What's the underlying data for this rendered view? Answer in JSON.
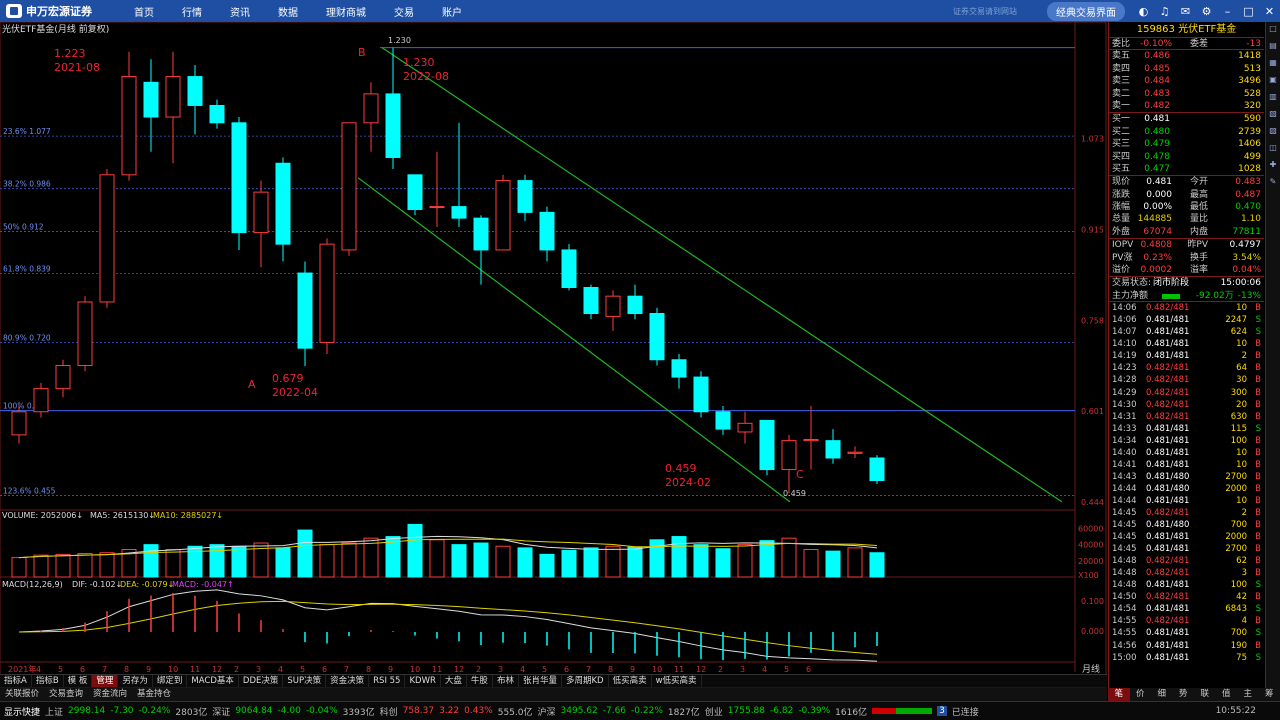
{
  "app": {
    "logo": "申万宏源证券",
    "nav": [
      "首页",
      "行情",
      "资讯",
      "数据",
      "理财商城",
      "交易",
      "账户"
    ],
    "hint": "证券交易请到网站",
    "classic_btn": "经典交易界面"
  },
  "chart": {
    "title": "光伏ETF基金(月线 前复权)",
    "fib_levels": [
      {
        "label": "23.6% 1.077",
        "value": 1.077
      },
      {
        "label": "38.2% 0.986",
        "value": 0.986
      },
      {
        "label": "50% 0.912",
        "value": 0.912
      },
      {
        "label": "61.8% 0.839",
        "value": 0.839
      },
      {
        "label": "80.9% 0.720",
        "value": 0.72
      },
      {
        "label": "100% 0.602",
        "value": 0.602
      },
      {
        "label": "123.6% 0.455",
        "value": 0.455
      }
    ],
    "y_ticks": [
      "1.073",
      "0.915",
      "0.758",
      "0.601",
      "0.444"
    ],
    "points": {
      "A": "A",
      "B": "B",
      "C": "C"
    },
    "annotations": [
      {
        "t1": "1.223",
        "t2": "2021-08"
      },
      {
        "t1": "1.230",
        "t2": "2022-08"
      },
      {
        "t1": "0.679",
        "t2": "2022-04"
      },
      {
        "t1": "0.459",
        "t2": "2024-02"
      }
    ],
    "hi_label": "1.230",
    "lo_label": "0.459",
    "volume_header": {
      "a": "VOLUME: 2052006↓",
      "b": "MA5: 2615130↓",
      "c": "MA10: 2885027↓"
    },
    "vol_ticks": [
      "60000",
      "40000",
      "20000",
      "X100"
    ],
    "macd_header": {
      "a": "MACD(12,26,9)",
      "b": "DIF: -0.102↓",
      "c": "DEA: -0.079↓",
      "d": "MACD: -0.047↑"
    },
    "macd_ticks": [
      "0.100",
      "0.000"
    ],
    "xlabels": [
      "2021年",
      "4",
      "5",
      "6",
      "7",
      "8",
      "9",
      "10",
      "11",
      "12",
      "2",
      "3",
      "4",
      "5",
      "6",
      "7",
      "8",
      "9",
      "10",
      "11",
      "12",
      "2",
      "3",
      "4",
      "5",
      "6",
      "7",
      "8",
      "9",
      "10",
      "11",
      "12",
      "2",
      "3",
      "4",
      "5",
      "6"
    ],
    "period": "月线"
  },
  "chart_data": {
    "type": "candlestick",
    "series": [
      {
        "name": "光伏ETF基金",
        "candles": [
          [
            0.56,
            0.6,
            0.61,
            0.545
          ],
          [
            0.6,
            0.64,
            0.65,
            0.59
          ],
          [
            0.64,
            0.68,
            0.69,
            0.625
          ],
          [
            0.68,
            0.79,
            0.8,
            0.67
          ],
          [
            0.79,
            1.01,
            1.02,
            0.78
          ],
          [
            1.01,
            1.18,
            1.223,
            1.0
          ],
          [
            1.17,
            1.11,
            1.21,
            1.05
          ],
          [
            1.11,
            1.18,
            1.223,
            1.03
          ],
          [
            1.18,
            1.13,
            1.2,
            1.08
          ],
          [
            1.13,
            1.1,
            1.14,
            1.09
          ],
          [
            1.1,
            0.91,
            1.11,
            0.88
          ],
          [
            0.91,
            0.98,
            1.0,
            0.85
          ],
          [
            1.03,
            0.89,
            1.04,
            0.86
          ],
          [
            0.84,
            0.71,
            0.86,
            0.679
          ],
          [
            0.72,
            0.89,
            0.9,
            0.7
          ],
          [
            0.88,
            1.1,
            1.1,
            0.87
          ],
          [
            1.1,
            1.15,
            1.17,
            1.05
          ],
          [
            1.15,
            1.04,
            1.23,
            1.02
          ],
          [
            1.01,
            0.95,
            1.01,
            0.94
          ],
          [
            0.955,
            0.955,
            1.05,
            0.92
          ],
          [
            0.955,
            0.935,
            1.1,
            0.92
          ],
          [
            0.935,
            0.88,
            0.94,
            0.82
          ],
          [
            0.88,
            1.0,
            1.01,
            0.88
          ],
          [
            1.0,
            0.945,
            1.01,
            0.93
          ],
          [
            0.945,
            0.88,
            0.955,
            0.86
          ],
          [
            0.88,
            0.815,
            0.89,
            0.81
          ],
          [
            0.815,
            0.77,
            0.82,
            0.76
          ],
          [
            0.765,
            0.8,
            0.81,
            0.74
          ],
          [
            0.8,
            0.77,
            0.82,
            0.76
          ],
          [
            0.77,
            0.69,
            0.78,
            0.68
          ],
          [
            0.69,
            0.66,
            0.7,
            0.64
          ],
          [
            0.66,
            0.6,
            0.67,
            0.59
          ],
          [
            0.6,
            0.57,
            0.61,
            0.56
          ],
          [
            0.565,
            0.58,
            0.6,
            0.545
          ],
          [
            0.585,
            0.5,
            0.585,
            0.49
          ],
          [
            0.5,
            0.55,
            0.56,
            0.459
          ],
          [
            0.55,
            0.552,
            0.61,
            0.5
          ],
          [
            0.55,
            0.52,
            0.57,
            0.51
          ],
          [
            0.528,
            0.53,
            0.54,
            0.52
          ],
          [
            0.52,
            0.481,
            0.525,
            0.475
          ]
        ]
      }
    ],
    "volume": [
      24000,
      27000,
      28000,
      29000,
      30000,
      34000,
      40000,
      34000,
      38000,
      40000,
      38000,
      42000,
      36000,
      58000,
      40000,
      42000,
      48000,
      50000,
      65000,
      46000,
      40000,
      42000,
      38000,
      36000,
      28000,
      33000,
      36000,
      38000,
      37000,
      46000,
      50000,
      40000,
      35000,
      40000,
      45000,
      48000,
      34000,
      32000,
      36000,
      30000
    ]
  },
  "quote": {
    "code": "159863",
    "name": "光伏ETF基金",
    "weibi": {
      "k1": "委比",
      "v1": "-0.10%",
      "k2": "委差",
      "v2": "-13"
    },
    "asks": [
      {
        "l": "卖五",
        "p": "0.486",
        "v": "1418"
      },
      {
        "l": "卖四",
        "p": "0.485",
        "v": "513"
      },
      {
        "l": "卖三",
        "p": "0.484",
        "v": "3496"
      },
      {
        "l": "卖二",
        "p": "0.483",
        "v": "528"
      },
      {
        "l": "卖一",
        "p": "0.482",
        "v": "320"
      }
    ],
    "bids": [
      {
        "l": "买一",
        "p": "0.481",
        "v": "590"
      },
      {
        "l": "买二",
        "p": "0.480",
        "v": "2739"
      },
      {
        "l": "买三",
        "p": "0.479",
        "v": "1406"
      },
      {
        "l": "买四",
        "p": "0.478",
        "v": "499"
      },
      {
        "l": "买五",
        "p": "0.477",
        "v": "1028"
      }
    ],
    "stats": [
      {
        "k1": "现价",
        "v1": "0.481",
        "c1": "wht",
        "k2": "今开",
        "v2": "0.483",
        "c2": "red"
      },
      {
        "k1": "涨跌",
        "v1": "0.000",
        "c1": "wht",
        "k2": "最高",
        "v2": "0.487",
        "c2": "red"
      },
      {
        "k1": "涨幅",
        "v1": "0.00%",
        "c1": "wht",
        "k2": "最低",
        "v2": "0.470",
        "c2": "green"
      },
      {
        "k1": "总量",
        "v1": "144885",
        "c1": "yel",
        "k2": "量比",
        "v2": "1.10",
        "c2": "yel"
      },
      {
        "k1": "外盘",
        "v1": "67074",
        "c1": "red",
        "k2": "内盘",
        "v2": "77811",
        "c2": "green"
      }
    ],
    "stats2": [
      {
        "k1": "IOPV",
        "v1": "0.4808",
        "c1": "red",
        "k2": "昨PV",
        "v2": "0.4797",
        "c2": "wht"
      },
      {
        "k1": "PV涨",
        "v1": "0.23%",
        "c1": "red",
        "k2": "换手",
        "v2": "3.54%",
        "c2": "yel"
      },
      {
        "k1": "溢价",
        "v1": "0.0002",
        "c1": "red",
        "k2": "溢率",
        "v2": "0.04%",
        "c2": "red"
      }
    ],
    "state": {
      "label": "交易状态:",
      "value": "闭市阶段",
      "time": "15:00:06"
    },
    "flow": {
      "label": "主力净额",
      "value": "-92.02万",
      "pct": "-13%"
    },
    "ticks": [
      {
        "t": "14:06",
        "p": "0.482/481",
        "v": "10",
        "f": "B"
      },
      {
        "t": "14:06",
        "p": "0.481/481",
        "v": "2247",
        "f": "S"
      },
      {
        "t": "14:07",
        "p": "0.481/481",
        "v": "624",
        "f": "S"
      },
      {
        "t": "14:10",
        "p": "0.481/481",
        "v": "10",
        "f": "B"
      },
      {
        "t": "14:19",
        "p": "0.481/481",
        "v": "2",
        "f": "B"
      },
      {
        "t": "14:23",
        "p": "0.482/481",
        "v": "64",
        "f": "B"
      },
      {
        "t": "14:28",
        "p": "0.482/481",
        "v": "30",
        "f": "B"
      },
      {
        "t": "14:29",
        "p": "0.482/481",
        "v": "300",
        "f": "B"
      },
      {
        "t": "14:30",
        "p": "0.482/481",
        "v": "20",
        "f": "B"
      },
      {
        "t": "14:31",
        "p": "0.482/481",
        "v": "630",
        "f": "B"
      },
      {
        "t": "14:33",
        "p": "0.481/481",
        "v": "115",
        "f": "S"
      },
      {
        "t": "14:34",
        "p": "0.481/481",
        "v": "100",
        "f": "B"
      },
      {
        "t": "14:40",
        "p": "0.481/481",
        "v": "10",
        "f": "B"
      },
      {
        "t": "14:41",
        "p": "0.481/481",
        "v": "10",
        "f": "B"
      },
      {
        "t": "14:43",
        "p": "0.481/480",
        "v": "2700",
        "f": "B"
      },
      {
        "t": "14:44",
        "p": "0.481/480",
        "v": "2000",
        "f": "B"
      },
      {
        "t": "14:44",
        "p": "0.481/481",
        "v": "10",
        "f": "B"
      },
      {
        "t": "14:45",
        "p": "0.482/481",
        "v": "2",
        "f": "B"
      },
      {
        "t": "14:45",
        "p": "0.481/480",
        "v": "700",
        "f": "B"
      },
      {
        "t": "14:45",
        "p": "0.481/481",
        "v": "2000",
        "f": "B"
      },
      {
        "t": "14:45",
        "p": "0.481/481",
        "v": "2700",
        "f": "B"
      },
      {
        "t": "14:48",
        "p": "0.482/481",
        "v": "62",
        "f": "B"
      },
      {
        "t": "14:48",
        "p": "0.482/481",
        "v": "3",
        "f": "B"
      },
      {
        "t": "14:48",
        "p": "0.481/481",
        "v": "100",
        "f": "S"
      },
      {
        "t": "14:50",
        "p": "0.482/481",
        "v": "42",
        "f": "B"
      },
      {
        "t": "14:54",
        "p": "0.481/481",
        "v": "6843",
        "f": "S"
      },
      {
        "t": "14:55",
        "p": "0.482/481",
        "v": "4",
        "f": "B"
      },
      {
        "t": "14:55",
        "p": "0.481/481",
        "v": "700",
        "f": "S"
      },
      {
        "t": "14:56",
        "p": "0.481/481",
        "v": "190",
        "f": "B"
      },
      {
        "t": "15:00",
        "p": "0.481/481",
        "v": "75",
        "f": "S"
      }
    ]
  },
  "tabs": [
    "指标A",
    "指标B",
    "模 板",
    "管理",
    "另存为",
    "绑定到",
    "MACD基本",
    "DDE决策",
    "SUP决策",
    "资金决策",
    "RSI 55",
    "KDWR",
    "大盘",
    "牛股",
    "布林",
    "张肖华量",
    "多周期KD",
    "低买高卖",
    "w低买高卖"
  ],
  "sublinks": [
    "关联报价",
    "交易查询",
    "资金流向",
    "基金持仓"
  ],
  "rtabs": [
    "笔",
    "价",
    "细",
    "势",
    "联",
    "值",
    "主",
    "筹"
  ],
  "status": {
    "quick": "显示快捷",
    "sh": {
      "n": "上证",
      "p": "2998.14",
      "c": "-7.30",
      "pct": "-0.24%",
      "v": "2803亿"
    },
    "sz": {
      "n": "深证",
      "p": "9064.84",
      "c": "-4.00",
      "pct": "-0.04%",
      "v": "3393亿"
    },
    "kc": {
      "n": "科创",
      "p": "758.37",
      "c": "3.22",
      "pct": "0.43%",
      "v": "555.0亿"
    },
    "hs": {
      "n": "沪深",
      "p": "3495.62",
      "c": "-7.66",
      "pct": "-0.22%",
      "v": "1827亿"
    },
    "cy": {
      "n": "创业",
      "p": "1755.88",
      "c": "-6.82",
      "pct": "-0.39%",
      "v": "1616亿"
    },
    "conn": "已连接",
    "time": "10:55:22"
  },
  "colors": {
    "up": "#ff3d3d",
    "down": "#00ffff",
    "fib": "#3b5bd6",
    "channel": "#1eb81e",
    "grid": "#6a1a1a"
  }
}
